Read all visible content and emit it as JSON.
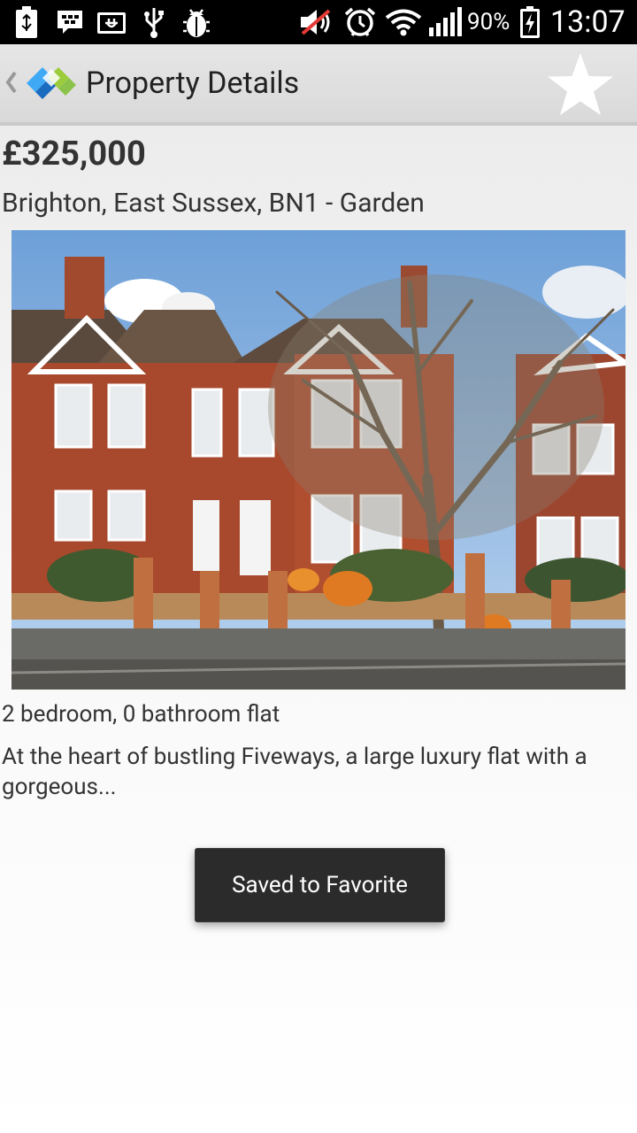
{
  "status_bar": {
    "battery_percent": "90%",
    "time": "13:07",
    "icons": [
      "battery-usb-icon",
      "bbm-icon",
      "charging-plug-icon",
      "usb-icon",
      "debug-bug-icon",
      "mute-icon",
      "alarm-icon",
      "wifi-icon",
      "signal-icon",
      "battery-charging-icon"
    ]
  },
  "action_bar": {
    "title": "Property Details",
    "favorite_icon": "star-icon"
  },
  "listing": {
    "price": "£325,000",
    "address": "Brighton, East Sussex, BN1 - Garden",
    "summary": "2 bedroom, 0 bathroom flat",
    "description": "At the heart of bustling Fiveways, a large luxury flat with a gorgeous..."
  },
  "toast": {
    "message": "Saved to Favorite"
  },
  "colors": {
    "action_bar_bg": "#dddddd",
    "status_bar_bg": "#000000",
    "toast_bg": "#2b2b2b"
  }
}
